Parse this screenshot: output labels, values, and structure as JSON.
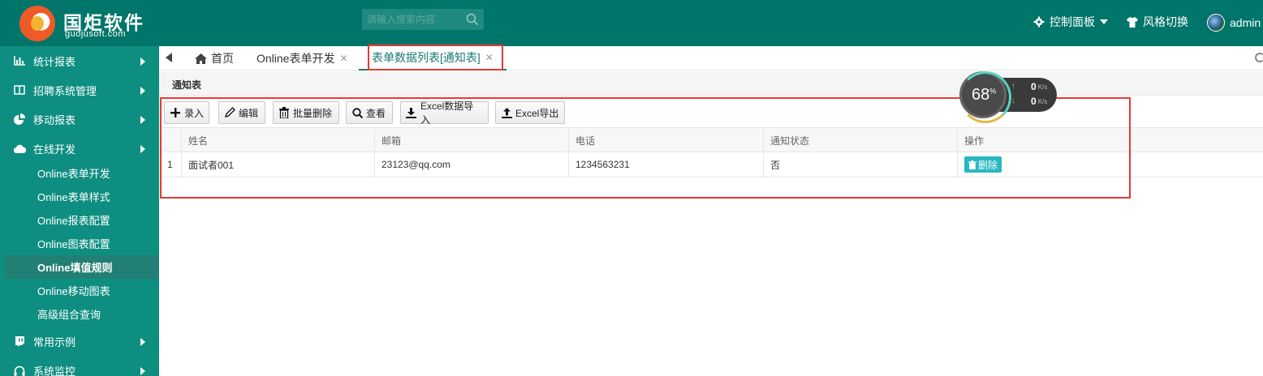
{
  "header": {
    "logo_cn": "国炬软件",
    "logo_en": "guojusoft.com",
    "search_placeholder": "请输入搜索内容",
    "control_panel": "控制面板",
    "style_switch": "风格切换",
    "user": "admin"
  },
  "sidebar": {
    "items": [
      {
        "label": "统计报表",
        "icon": "bar-chart-icon"
      },
      {
        "label": "招聘系统管理",
        "icon": "columns-icon"
      },
      {
        "label": "移动报表",
        "icon": "pie-chart-icon"
      },
      {
        "label": "在线开发",
        "icon": "cloud-icon"
      }
    ],
    "sub_items": [
      "Online表单开发",
      "Online表单样式",
      "Online报表配置",
      "Online图表配置",
      "Online填值规则",
      "Online移动图表",
      "高级组合查询"
    ],
    "active_sub": "Online填值规则",
    "bottom_items": [
      {
        "label": "常用示例",
        "icon": "twitch-icon"
      },
      {
        "label": "系统监控",
        "icon": "headphones-icon"
      }
    ]
  },
  "tabs": [
    {
      "label": "首页",
      "icon": "home-icon",
      "closable": false
    },
    {
      "label": "Online表单开发",
      "closable": true
    },
    {
      "label": "表单数据列表[通知表]",
      "closable": true,
      "active": true
    }
  ],
  "page": {
    "title": "通知表"
  },
  "toolbar": {
    "add": "录入",
    "edit": "编辑",
    "batch_delete": "批量删除",
    "view": "查看",
    "excel_import": "Excel数据导入",
    "excel_export": "Excel导出"
  },
  "table": {
    "columns": [
      "姓名",
      "邮箱",
      "电话",
      "通知状态",
      "操作"
    ],
    "rows": [
      {
        "index": "1",
        "name": "面试者001",
        "email": "23123@qq.com",
        "phone": "1234563231",
        "status": "否",
        "action": "删除"
      }
    ]
  },
  "speed_widget": {
    "percent": "68",
    "percent_unit": "%",
    "up": "0",
    "down": "0",
    "unit": "K/s"
  },
  "colors": {
    "header_bg": "#00756a",
    "sidebar_bg": "#0e8e80",
    "highlight": "#e53935",
    "delete_btn": "#2ab7c0"
  }
}
